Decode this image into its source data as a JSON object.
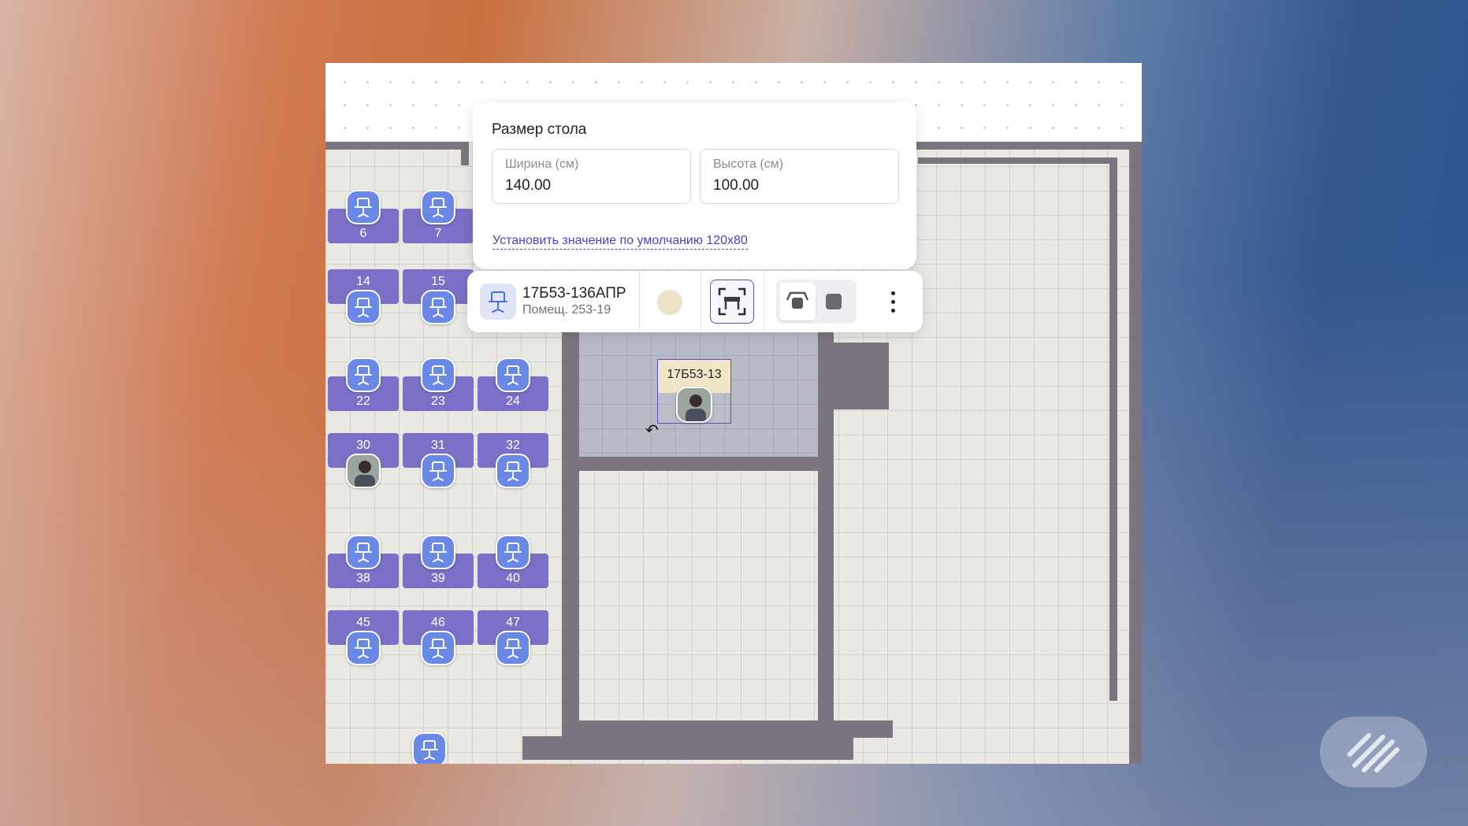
{
  "size_panel": {
    "title": "Размер стола",
    "width_label": "Ширина (см)",
    "width_value": "140.00",
    "height_label": "Высота (см)",
    "height_value": "100.00",
    "default_link": "Установить значение по умолчанию 120x80"
  },
  "toolbar": {
    "desk_id": "17Б53-136АПР",
    "room": "Помещ. 253-19",
    "desk_color": "#ece2c8",
    "icons": [
      "chair-icon",
      "resize-icon",
      "desk-shape-icon",
      "square-shape-icon",
      "more-vertical-icon"
    ]
  },
  "selected_desk": {
    "label": "17Б53-13"
  },
  "desks": [
    {
      "n": "6"
    },
    {
      "n": "7"
    },
    {
      "n": "14"
    },
    {
      "n": "15"
    },
    {
      "n": "22"
    },
    {
      "n": "23"
    },
    {
      "n": "24"
    },
    {
      "n": "30"
    },
    {
      "n": "31"
    },
    {
      "n": "32"
    },
    {
      "n": "38"
    },
    {
      "n": "39"
    },
    {
      "n": "40"
    },
    {
      "n": "45"
    },
    {
      "n": "46"
    },
    {
      "n": "47"
    }
  ],
  "colors": {
    "desk": "#7a70c8",
    "chair": "#6a88e6",
    "accent": "#4a3fcf",
    "wall": "#7c7480"
  }
}
